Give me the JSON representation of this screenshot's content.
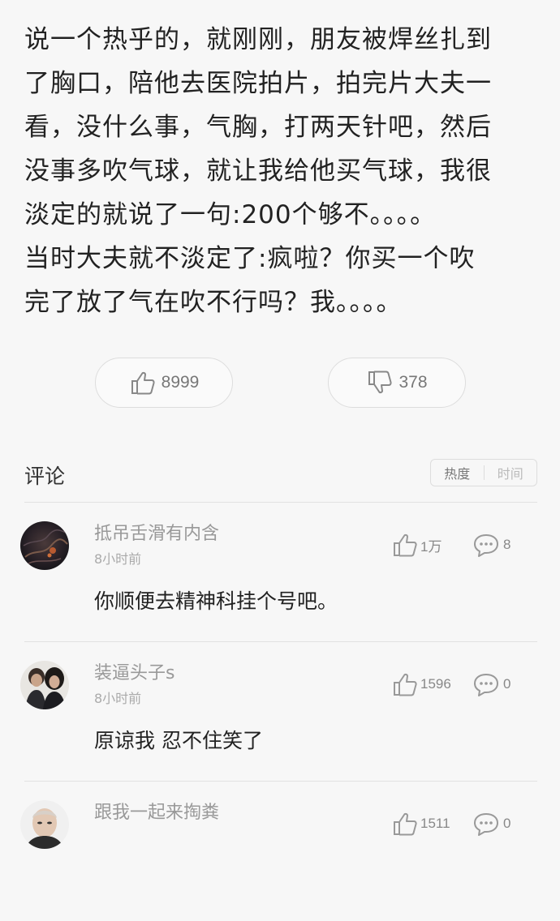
{
  "post": {
    "lines": [
      "说一个热乎的，就刚刚，朋友被焊丝扎到",
      "了胸口，陪他去医院拍片，拍完片大夫一",
      "看，没什么事，气胸，打两天针吧，然后",
      "没事多吹气球，就让我给他买气球，我很",
      "淡定的就说了一句:200个够不。。。。",
      "当时大夫就不淡定了:疯啦？你买一个吹",
      "完了放了气在吹不行吗？我。。。。"
    ],
    "upvotes": "8999",
    "downvotes": "378"
  },
  "comments_section": {
    "title": "评论",
    "sort_hot": "热度",
    "sort_time": "时间"
  },
  "comments": [
    {
      "author": "抵吊舌滑有内含",
      "time": "8小时前",
      "body": "你顺便去精神科挂个号吧。",
      "likes": "1万",
      "replies": "8"
    },
    {
      "author": "装逼头子s",
      "time": "8小时前",
      "body": "原谅我  忍不住笑了",
      "likes": "1596",
      "replies": "0"
    },
    {
      "author": "跟我一起来掏粪",
      "time": "",
      "body": "",
      "likes": "1511",
      "replies": "0"
    }
  ],
  "colors": {
    "background": "#f7f7f7",
    "text": "#222222",
    "muted": "#999999",
    "border": "#dddddd"
  },
  "icons": {
    "upvote": "thumbs-up-icon",
    "downvote": "thumbs-down-icon",
    "reply": "speech-bubble-icon"
  }
}
